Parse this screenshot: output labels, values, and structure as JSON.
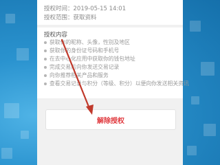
{
  "auth_info": {
    "time_line": "授权时间：2019-05-15 14:01",
    "scope_line": "授权范围：获取资料"
  },
  "permissions": {
    "title": "授权内容",
    "items": [
      "获取你的昵称、头像，性别及地区",
      "获取你的身份证号码和手机号",
      "在去中心化应用中获取你的钱包地址",
      "完成交易后向你发送交易记录",
      "向你推荐相关产品和服务",
      "查看交易记录与积分（等级、积分）以便向你发送相关资讯"
    ]
  },
  "actions": {
    "revoke_label": "解除授权"
  },
  "colors": {
    "accent": "#e0393e",
    "arrow": "#c0392b",
    "background": "#1f88c2"
  }
}
